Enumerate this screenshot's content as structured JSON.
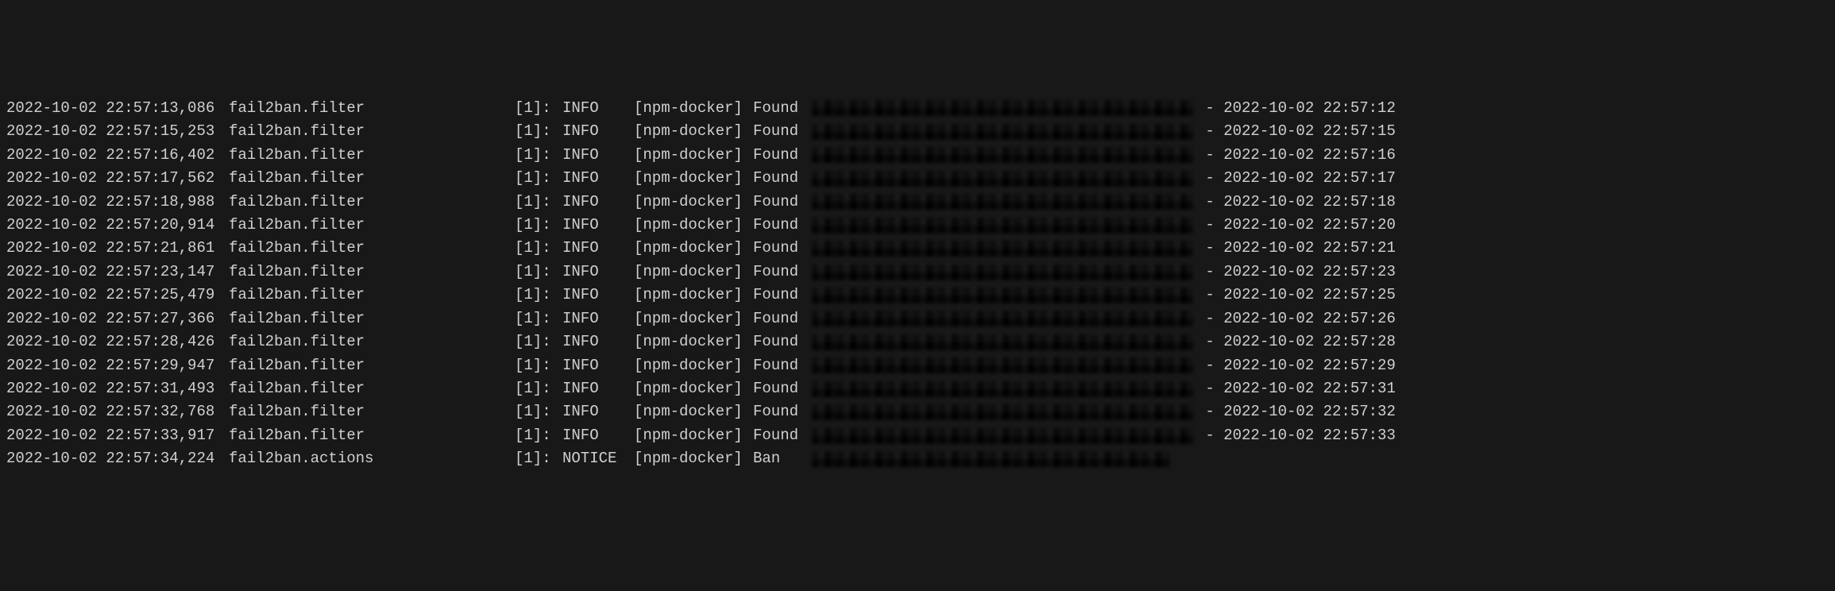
{
  "logs": [
    {
      "timestamp": "2022-10-02 22:57:13,086",
      "module": "fail2ban.filter",
      "thread": "[1]:",
      "level": "INFO",
      "jail": "[npm-docker]",
      "action": "Found",
      "trail": " - 2022-10-02 22:57:12",
      "redacted": "long"
    },
    {
      "timestamp": "2022-10-02 22:57:15,253",
      "module": "fail2ban.filter",
      "thread": "[1]:",
      "level": "INFO",
      "jail": "[npm-docker]",
      "action": "Found",
      "trail": " - 2022-10-02 22:57:15",
      "redacted": "long"
    },
    {
      "timestamp": "2022-10-02 22:57:16,402",
      "module": "fail2ban.filter",
      "thread": "[1]:",
      "level": "INFO",
      "jail": "[npm-docker]",
      "action": "Found",
      "trail": " - 2022-10-02 22:57:16",
      "redacted": "long"
    },
    {
      "timestamp": "2022-10-02 22:57:17,562",
      "module": "fail2ban.filter",
      "thread": "[1]:",
      "level": "INFO",
      "jail": "[npm-docker]",
      "action": "Found",
      "trail": " - 2022-10-02 22:57:17",
      "redacted": "long"
    },
    {
      "timestamp": "2022-10-02 22:57:18,988",
      "module": "fail2ban.filter",
      "thread": "[1]:",
      "level": "INFO",
      "jail": "[npm-docker]",
      "action": "Found",
      "trail": " - 2022-10-02 22:57:18",
      "redacted": "long"
    },
    {
      "timestamp": "2022-10-02 22:57:20,914",
      "module": "fail2ban.filter",
      "thread": "[1]:",
      "level": "INFO",
      "jail": "[npm-docker]",
      "action": "Found",
      "trail": " - 2022-10-02 22:57:20",
      "redacted": "long"
    },
    {
      "timestamp": "2022-10-02 22:57:21,861",
      "module": "fail2ban.filter",
      "thread": "[1]:",
      "level": "INFO",
      "jail": "[npm-docker]",
      "action": "Found",
      "trail": " - 2022-10-02 22:57:21",
      "redacted": "long"
    },
    {
      "timestamp": "2022-10-02 22:57:23,147",
      "module": "fail2ban.filter",
      "thread": "[1]:",
      "level": "INFO",
      "jail": "[npm-docker]",
      "action": "Found",
      "trail": " - 2022-10-02 22:57:23",
      "redacted": "long"
    },
    {
      "timestamp": "2022-10-02 22:57:25,479",
      "module": "fail2ban.filter",
      "thread": "[1]:",
      "level": "INFO",
      "jail": "[npm-docker]",
      "action": "Found",
      "trail": " - 2022-10-02 22:57:25",
      "redacted": "long"
    },
    {
      "timestamp": "2022-10-02 22:57:27,366",
      "module": "fail2ban.filter",
      "thread": "[1]:",
      "level": "INFO",
      "jail": "[npm-docker]",
      "action": "Found",
      "trail": " - 2022-10-02 22:57:26",
      "redacted": "long"
    },
    {
      "timestamp": "2022-10-02 22:57:28,426",
      "module": "fail2ban.filter",
      "thread": "[1]:",
      "level": "INFO",
      "jail": "[npm-docker]",
      "action": "Found",
      "trail": " - 2022-10-02 22:57:28",
      "redacted": "long"
    },
    {
      "timestamp": "2022-10-02 22:57:29,947",
      "module": "fail2ban.filter",
      "thread": "[1]:",
      "level": "INFO",
      "jail": "[npm-docker]",
      "action": "Found",
      "trail": " - 2022-10-02 22:57:29",
      "redacted": "long"
    },
    {
      "timestamp": "2022-10-02 22:57:31,493",
      "module": "fail2ban.filter",
      "thread": "[1]:",
      "level": "INFO",
      "jail": "[npm-docker]",
      "action": "Found",
      "trail": " - 2022-10-02 22:57:31",
      "redacted": "long"
    },
    {
      "timestamp": "2022-10-02 22:57:32,768",
      "module": "fail2ban.filter",
      "thread": "[1]:",
      "level": "INFO",
      "jail": "[npm-docker]",
      "action": "Found",
      "trail": " - 2022-10-02 22:57:32",
      "redacted": "long"
    },
    {
      "timestamp": "2022-10-02 22:57:33,917",
      "module": "fail2ban.filter",
      "thread": "[1]:",
      "level": "INFO",
      "jail": "[npm-docker]",
      "action": "Found",
      "trail": " - 2022-10-02 22:57:33",
      "redacted": "long"
    },
    {
      "timestamp": "2022-10-02 22:57:34,224",
      "module": "fail2ban.actions",
      "thread": "[1]:",
      "level": "NOTICE",
      "jail": "[npm-docker]",
      "action": "Ban",
      "trail": "",
      "redacted": "short"
    }
  ]
}
